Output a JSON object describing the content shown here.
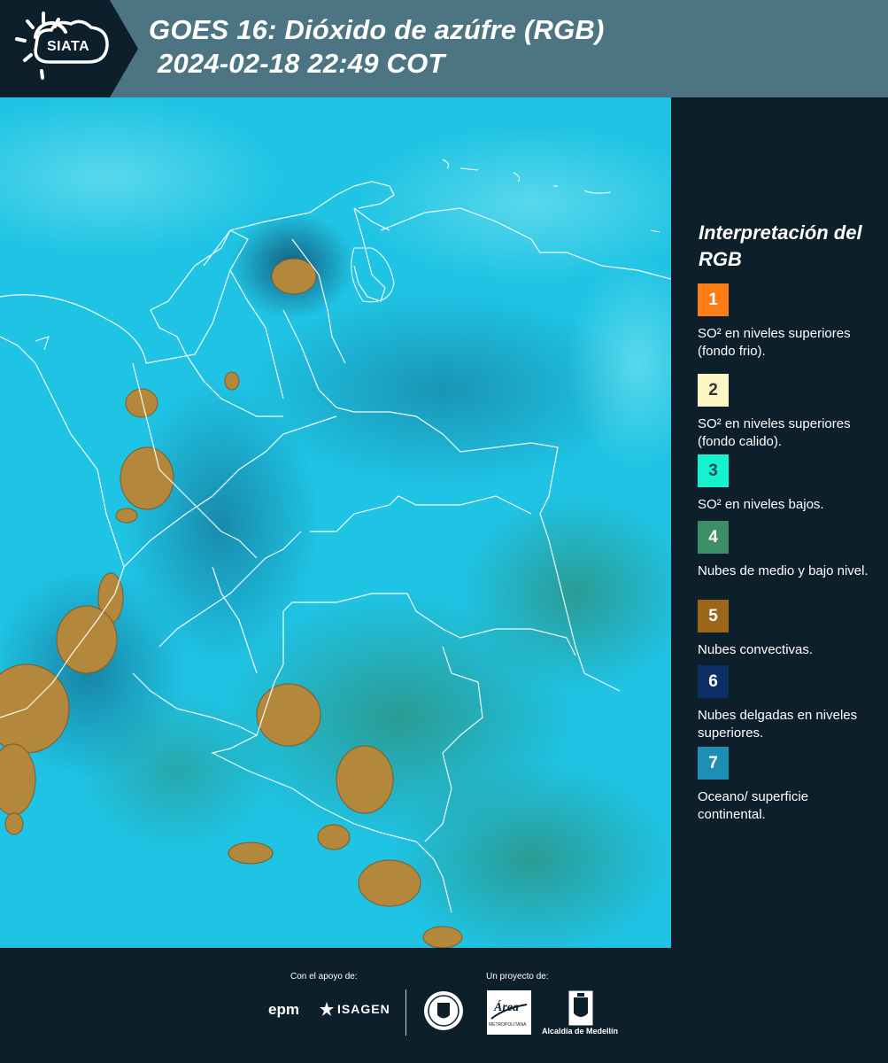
{
  "header": {
    "title_line1": "GOES 16: Dióxido de azúfre (RGB)",
    "title_line2": "2024-02-18 22:49 COT",
    "logo_text": "SIATA",
    "background_color": "#4d7482"
  },
  "map": {
    "background_color": "#1fc3e4",
    "convective_cloud_color": "#b3873c",
    "boundary_color": "#ffffff"
  },
  "legend": {
    "title": "Interpretación del RGB",
    "items": [
      {
        "number": "1",
        "label": "SO² en niveles superiores (fondo frio).",
        "color": "#fb7d13",
        "text_color": "#ffffff"
      },
      {
        "number": "2",
        "label": "SO² en niveles superiores (fondo calido).",
        "color": "#fdf6c4",
        "text_color": "#333333"
      },
      {
        "number": "3",
        "label": "SO² en niveles bajos.",
        "color": "#14f2cf",
        "text_color": "#1c4d4d"
      },
      {
        "number": "4",
        "label": "Nubes de medio y bajo nivel.",
        "color": "#3c8e66",
        "text_color": "#ffffff"
      },
      {
        "number": "5",
        "label": "Nubes convectivas.",
        "color": "#9c6618",
        "text_color": "#ffffff"
      },
      {
        "number": "6",
        "label": "Nubes delgadas en niveles superiores.",
        "color": "#0e2f66",
        "text_color": "#ffffff"
      },
      {
        "number": "7",
        "label": "Oceano/ superficie continental.",
        "color": "#1e8fb4",
        "text_color": "#ffffff"
      }
    ]
  },
  "footer": {
    "support_label": "Con el apoyo de:",
    "project_label": "Un proyecto de:",
    "epm": "epm",
    "isagen": "ISAGEN",
    "area_text": "Área",
    "area_sub": "METROPOLITANA",
    "alcaldia": "Alcaldía de Medellín"
  }
}
